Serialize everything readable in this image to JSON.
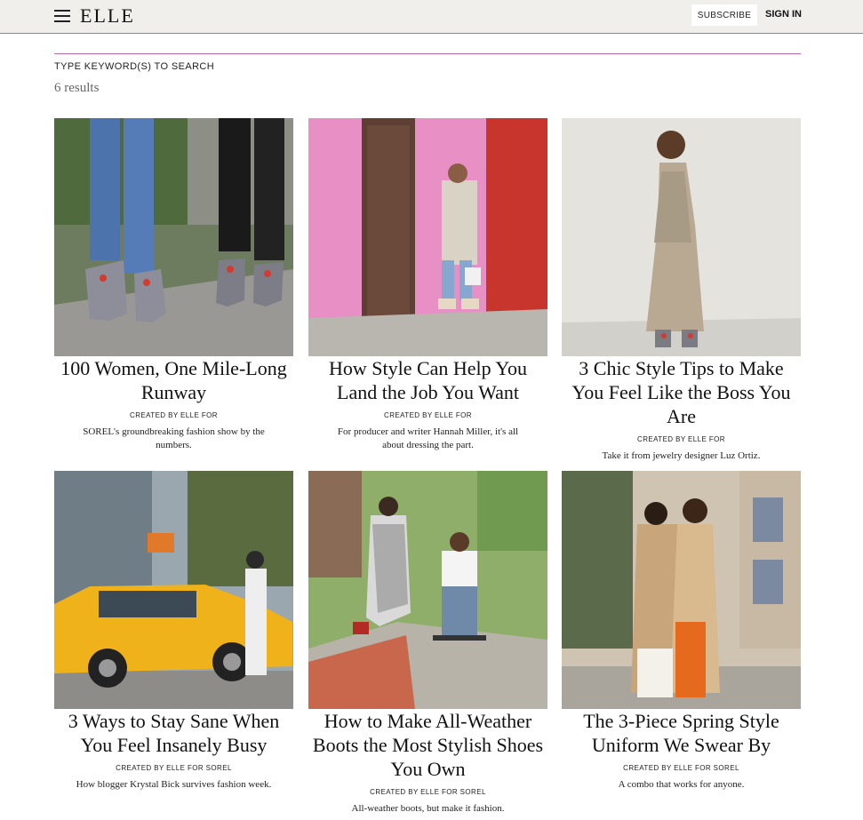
{
  "header": {
    "logo": "ELLE",
    "subscribe_label": "SUBSCRIBE",
    "signin_label": "SIGN IN",
    "menu_icon": "hamburger-menu-icon"
  },
  "search": {
    "placeholder": "TYPE KEYWORD(S) TO SEARCH",
    "results_count": "6 results"
  },
  "articles": [
    {
      "title": "100 Women, One Mile-Long Runway",
      "credit": "CREATED BY ELLE FOR",
      "dek": "SOREL's groundbreaking fashion show by the numbers."
    },
    {
      "title": "How Style Can Help You Land the Job You Want",
      "credit": "CREATED BY ELLE FOR",
      "dek": "For producer and writer Hannah Miller, it's all about dressing the part."
    },
    {
      "title": "3 Chic Style Tips to Make You Feel Like the Boss You Are",
      "credit": "CREATED BY ELLE FOR",
      "dek": "Take it from jewelry designer Luz Ortiz."
    },
    {
      "title": "3 Ways to Stay Sane When You Feel Insanely Busy",
      "credit": "CREATED BY ELLE FOR SOREL",
      "dek": "How blogger Krystal Bick survives fashion week."
    },
    {
      "title": "How to Make All-Weather Boots the Most Stylish Shoes You Own",
      "credit": "CREATED BY ELLE FOR SOREL",
      "dek": "All-weather boots, but make it fashion."
    },
    {
      "title": "The 3-Piece Spring Style Uniform We Swear By",
      "credit": "CREATED BY ELLE FOR SOREL",
      "dek": "A combo that works for anyone."
    }
  ],
  "colors": {
    "accent": "#b36ab3",
    "topbar_bg": "#f1efeb"
  }
}
